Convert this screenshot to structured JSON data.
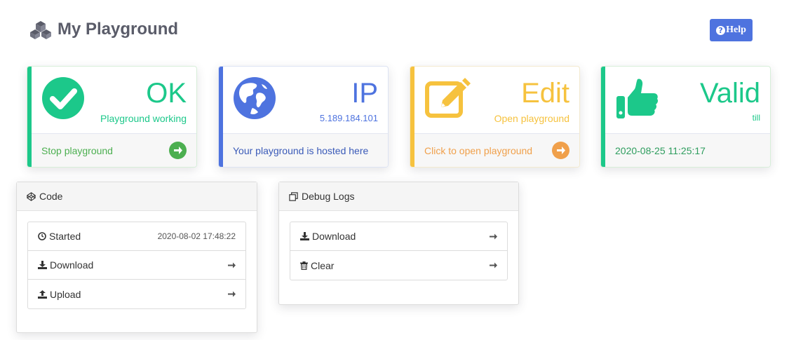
{
  "header": {
    "title": "My Playground",
    "logo_icon": "cubes-icon"
  },
  "help_button": {
    "label": "Help",
    "icon": "question-circle-icon"
  },
  "cards": {
    "status": {
      "big": "OK",
      "small": "Playground working",
      "footer": "Stop playground",
      "color": "#1cc88a",
      "footer_color": "#4caf50",
      "icon": "check-circle-icon"
    },
    "ip": {
      "big": "IP",
      "small": "5.189.184.101",
      "footer": "Your playground is hosted here",
      "color": "#4e73df",
      "icon": "globe-icon"
    },
    "edit": {
      "big": "Edit",
      "small": "Open playground",
      "footer": "Click to open playground",
      "color": "#f6c23e",
      "footer_color": "#f0a04b",
      "icon": "edit-icon"
    },
    "valid": {
      "big": "Valid",
      "small": "till",
      "footer": "2020-08-25 11:25:17",
      "color": "#1cc88a",
      "footer_color": "#2e9d5e",
      "icon": "thumbs-up-icon"
    }
  },
  "code_panel": {
    "title": "Code",
    "rows": [
      {
        "label": "Started",
        "value": "2020-08-02 17:48:22",
        "icon": "clock-icon"
      },
      {
        "label": "Download",
        "icon": "download-icon"
      },
      {
        "label": "Upload",
        "icon": "upload-icon"
      }
    ]
  },
  "debug_panel": {
    "title": "Debug Logs",
    "rows": [
      {
        "label": "Download",
        "icon": "download-icon"
      },
      {
        "label": "Clear",
        "icon": "trash-icon"
      }
    ]
  }
}
